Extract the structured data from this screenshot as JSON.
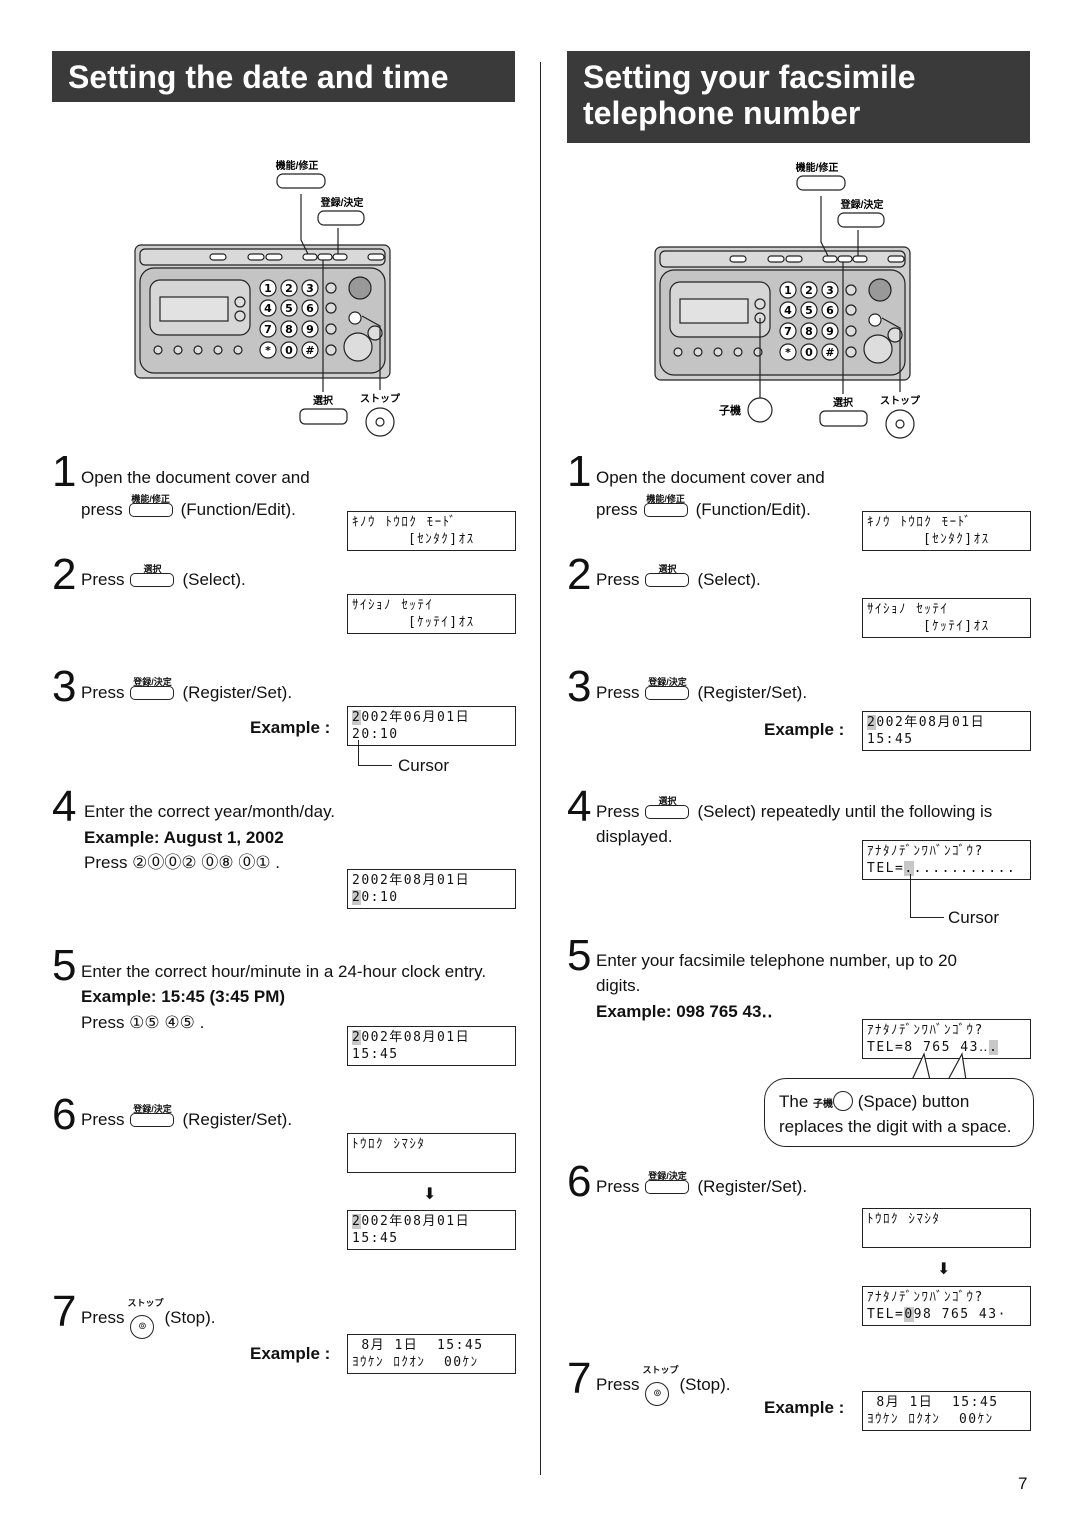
{
  "left": {
    "title": "Setting the date and time",
    "steps": [
      {
        "n": "1",
        "lines": [
          "Open the document cover and"
        ],
        "press": "press",
        "key": "機能/修正",
        "after": "(Function/Edit)."
      },
      {
        "n": "2",
        "press": "Press",
        "key": "選択",
        "after": "(Select)."
      },
      {
        "n": "3",
        "press": "Press",
        "key": "登録/決定",
        "after": "(Register/Set).",
        "example": "Example :"
      },
      {
        "n": "4",
        "text": "Enter the correct year/month/day.",
        "example": "Example: August 1, 2002",
        "press": "Press ②⓪⓪② ⓪⑧ ⓪① ."
      },
      {
        "n": "5",
        "text": "Enter the correct hour/minute in a 24-hour clock entry.",
        "example": "Example: 15:45 (3:45 PM)",
        "press": "Press ①⑤ ④⑤ ."
      },
      {
        "n": "6",
        "press": "Press",
        "key": "登録/決定",
        "after": "(Register/Set)."
      },
      {
        "n": "7",
        "press": "Press",
        "key": "ストップ",
        "after": "(Stop).",
        "example": "Example :"
      }
    ],
    "cursor_label": "Cursor"
  },
  "right": {
    "title_line1": "Setting your facsimile",
    "title_line2": "telephone number",
    "steps": [
      {
        "n": "1",
        "lines": [
          "Open the document cover and"
        ],
        "press": "press",
        "key": "機能/修正",
        "after": "(Function/Edit)."
      },
      {
        "n": "2",
        "press": "Press",
        "key": "選択",
        "after": "(Select)."
      },
      {
        "n": "3",
        "press": "Press",
        "key": "登録/決定",
        "after": "(Register/Set).",
        "example": "Example :"
      },
      {
        "n": "4",
        "press": "Press",
        "key": "選択",
        "after": "(Select) repeatedly until the following is",
        "line2": "displayed."
      },
      {
        "n": "5",
        "text": "Enter your facsimile telephone number, up to 20",
        "line2": "digits.",
        "example": "Example: 098 765 43‥"
      },
      {
        "n": "6",
        "press": "Press",
        "key": "登録/決定",
        "after": "(Register/Set)."
      },
      {
        "n": "7",
        "press": "Press",
        "key": "ストップ",
        "after": "(Stop).",
        "example": "Example :"
      }
    ],
    "cursor_label": "Cursor",
    "bubble": {
      "pre": "The",
      "key": "子機",
      "post": "(Space) button",
      "line2": "replaces the digit with a space."
    }
  },
  "lcds": {
    "l1": [
      [
        {
          "t": "ｷﾉｳ ﾄｳﾛｸ ﾓｰﾄﾞ"
        }
      ],
      [
        {
          "t": "      [ｾﾝﾀｸ]ｵｽ"
        }
      ]
    ],
    "l2": [
      [
        {
          "t": "ｻｲｼｮﾉ ｾｯﾃｲ"
        }
      ],
      [
        {
          "t": "      [ｹｯﾃｲ]ｵｽ"
        }
      ]
    ],
    "l3": [
      [
        {
          "t": "2",
          "c": true
        },
        {
          "t": "002年06月01日"
        }
      ],
      [
        {
          "t": "20:10"
        }
      ]
    ],
    "l4": [
      [
        {
          "t": "2002年08月01日"
        }
      ],
      [
        {
          "t": "2",
          "c": true
        },
        {
          "t": "0:10"
        }
      ]
    ],
    "l5": [
      [
        {
          "t": "2",
          "c": true
        },
        {
          "t": "002年08月01日"
        }
      ],
      [
        {
          "t": "15:45"
        }
      ]
    ],
    "l6": [
      [
        {
          "t": "ﾄｳﾛｸ ｼﾏｼﾀ"
        }
      ],
      [
        {
          "t": ""
        }
      ]
    ],
    "l7": [
      [
        {
          "t": "2",
          "c": true
        },
        {
          "t": "002年08月01日"
        }
      ],
      [
        {
          "t": "15:45"
        }
      ]
    ],
    "l8": [
      [
        {
          "t": " 8月 1日  15:45"
        }
      ],
      [
        {
          "t": "ﾖｳｹﾝ ﾛｸｵﾝ  00ｹﾝ"
        }
      ]
    ],
    "r1": [
      [
        {
          "t": "ｷﾉｳ ﾄｳﾛｸ ﾓｰﾄﾞ"
        }
      ],
      [
        {
          "t": "      [ｾﾝﾀｸ]ｵｽ"
        }
      ]
    ],
    "r2": [
      [
        {
          "t": "ｻｲｼｮﾉ ｾｯﾃｲ"
        }
      ],
      [
        {
          "t": "      [ｹｯﾃｲ]ｵｽ"
        }
      ]
    ],
    "r3": [
      [
        {
          "t": "2",
          "c": true
        },
        {
          "t": "002年08月01日"
        }
      ],
      [
        {
          "t": "15:45"
        }
      ]
    ],
    "r4": [
      [
        {
          "t": "ｱﾅﾀﾉﾃﾞﾝﾜﾊﾞﾝｺﾞｳ?"
        }
      ],
      [
        {
          "t": "TEL="
        },
        {
          "t": ".",
          "c": true
        },
        {
          "t": "..........."
        }
      ]
    ],
    "r5": [
      [
        {
          "t": "ｱﾅﾀﾉﾃﾞﾝﾜﾊﾞﾝｺﾞｳ?"
        }
      ],
      [
        {
          "t": "TEL=8 765 43‥"
        },
        {
          "t": ".",
          "c": true
        }
      ]
    ],
    "r6": [
      [
        {
          "t": "ﾄｳﾛｸ ｼﾏｼﾀ"
        }
      ],
      [
        {
          "t": ""
        }
      ]
    ],
    "r7": [
      [
        {
          "t": "ｱﾅﾀﾉﾃﾞﾝﾜﾊﾞﾝｺﾞｳ?"
        }
      ],
      [
        {
          "t": "TEL="
        },
        {
          "t": "0",
          "c": true
        },
        {
          "t": "98 765 43·"
        }
      ]
    ],
    "r8": [
      [
        {
          "t": " 8月 1日  15:45"
        }
      ],
      [
        {
          "t": "ﾖｳｹﾝ ﾛｸｵﾝ  00ｹﾝ"
        }
      ]
    ]
  },
  "fax": {
    "function_label": "機能/修正",
    "register_label": "登録/決定",
    "select_label": "選択",
    "stop_label": "ストップ",
    "handset_label": "子機",
    "keypad": [
      "1",
      "2",
      "3",
      "4",
      "5",
      "6",
      "7",
      "8",
      "9",
      "*",
      "0",
      "#"
    ]
  },
  "down_arrow": "⬇",
  "page_number": "7"
}
